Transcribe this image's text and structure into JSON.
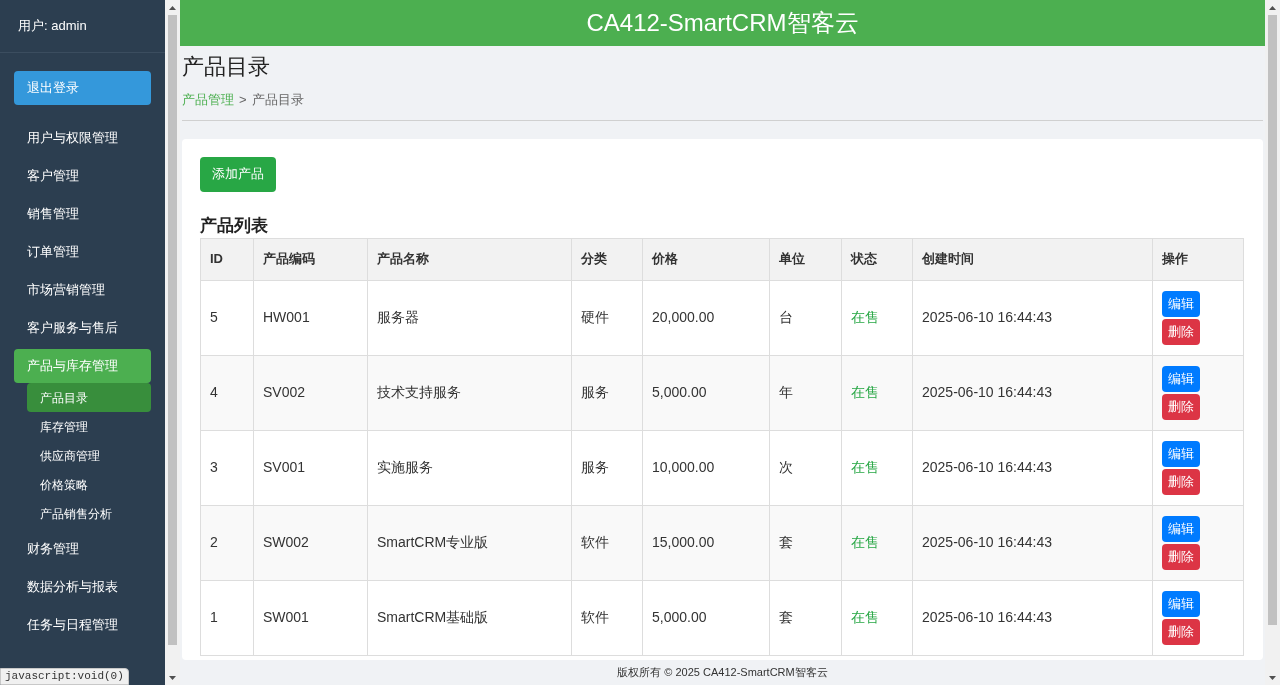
{
  "sidebar": {
    "user": "用户: admin",
    "logout": "退出登录",
    "items": [
      {
        "label": "用户与权限管理",
        "selected": false
      },
      {
        "label": "客户管理",
        "selected": false
      },
      {
        "label": "销售管理",
        "selected": false
      },
      {
        "label": "订单管理",
        "selected": false
      },
      {
        "label": "市场营销管理",
        "selected": false
      },
      {
        "label": "客户服务与售后",
        "selected": false
      },
      {
        "label": "产品与库存管理",
        "selected": true,
        "children": [
          {
            "label": "产品目录",
            "selected": true
          },
          {
            "label": "库存管理",
            "selected": false
          },
          {
            "label": "供应商管理",
            "selected": false
          },
          {
            "label": "价格策略",
            "selected": false
          },
          {
            "label": "产品销售分析",
            "selected": false
          }
        ]
      },
      {
        "label": "财务管理",
        "selected": false
      },
      {
        "label": "数据分析与报表",
        "selected": false
      },
      {
        "label": "任务与日程管理",
        "selected": false
      }
    ]
  },
  "header": {
    "title": "CA412-SmartCRM智客云"
  },
  "page": {
    "title": "产品目录",
    "breadcrumb": {
      "link": "产品管理",
      "separator": ">",
      "current": "产品目录"
    }
  },
  "add_button": "添加产品",
  "table": {
    "title": "产品列表",
    "columns": [
      "ID",
      "产品编码",
      "产品名称",
      "分类",
      "价格",
      "单位",
      "状态",
      "创建时间",
      "操作"
    ],
    "rows": [
      {
        "cells": [
          "5",
          "HW001",
          "服务器",
          "硬件",
          "20,000.00",
          "台",
          "在售",
          "2025-06-10 16:44:43"
        ],
        "actions": [
          "编辑",
          "删除"
        ]
      },
      {
        "cells": [
          "4",
          "SV002",
          "技术支持服务",
          "服务",
          "5,000.00",
          "年",
          "在售",
          "2025-06-10 16:44:43"
        ],
        "actions": [
          "编辑",
          "删除"
        ]
      },
      {
        "cells": [
          "3",
          "SV001",
          "实施服务",
          "服务",
          "10,000.00",
          "次",
          "在售",
          "2025-06-10 16:44:43"
        ],
        "actions": [
          "编辑",
          "删除"
        ]
      },
      {
        "cells": [
          "2",
          "SW002",
          "SmartCRM专业版",
          "软件",
          "15,000.00",
          "套",
          "在售",
          "2025-06-10 16:44:43"
        ],
        "actions": [
          "编辑",
          "删除"
        ]
      },
      {
        "cells": [
          "1",
          "SW001",
          "SmartCRM基础版",
          "软件",
          "5,000.00",
          "套",
          "在售",
          "2025-06-10 16:44:43"
        ],
        "actions": [
          "编辑",
          "删除"
        ]
      }
    ]
  },
  "footer": "版权所有 © 2025 CA412-SmartCRM智客云",
  "status_bar": "javascript:void(0)"
}
